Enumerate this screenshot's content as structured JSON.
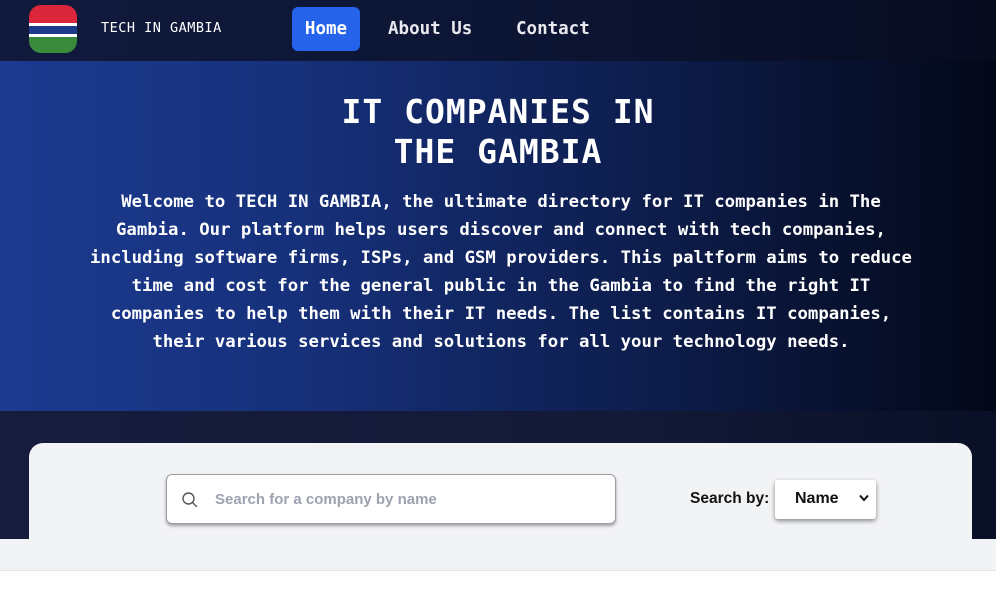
{
  "nav": {
    "brand": "TECH IN GAMBIA",
    "links": [
      {
        "label": "Home",
        "active": true
      },
      {
        "label": "About Us",
        "active": false
      },
      {
        "label": "Contact",
        "active": false
      }
    ]
  },
  "hero": {
    "title_line1": "IT COMPANIES IN",
    "title_line2": "THE GAMBIA",
    "description": "Welcome to TECH IN GAMBIA, the ultimate directory for IT companies in The Gambia. Our platform helps users discover and connect with tech companies, including software firms, ISPs, and GSM providers. This paltform aims to reduce time and cost for the general public in the Gambia to find the right IT companies to help them with their IT needs. The list contains IT companies, their various services and solutions for all your technology needs."
  },
  "search": {
    "placeholder": "Search for a company by name",
    "value": "",
    "by_label": "Search by:",
    "by_selected": "Name"
  },
  "icons": {
    "logo": "gambia-flag-icon",
    "search": "search-icon",
    "select": "chevron-down-icon"
  },
  "colors": {
    "accent": "#2563eb",
    "flag_red": "#d9263a",
    "flag_blue": "#1d3a8a",
    "flag_green": "#3a8a3c"
  }
}
